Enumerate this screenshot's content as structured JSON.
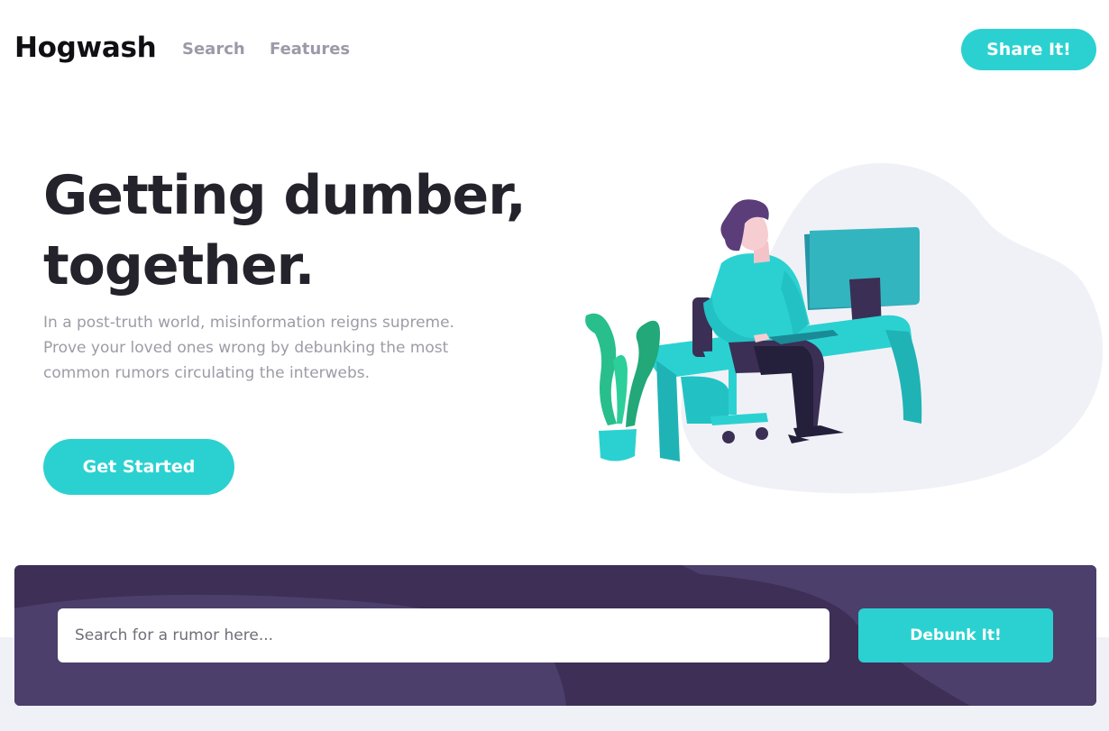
{
  "header": {
    "logo": "Hogwash",
    "nav": [
      {
        "label": "Search"
      },
      {
        "label": "Features"
      }
    ],
    "share_label": "Share It!"
  },
  "hero": {
    "title_line1": "Getting dumber,",
    "title_line2": "together.",
    "description": "In a post-truth world, misinformation reigns supreme. Prove your loved ones wrong by debunking the most common rumors circulating the interwebs.",
    "cta_label": "Get Started",
    "illustration_icon": "person-at-desk-illustration"
  },
  "search": {
    "placeholder": "Search for a rumor here...",
    "value": "",
    "button_label": "Debunk It!"
  },
  "colors": {
    "accent": "#2bd1d1",
    "panel_dark": "#3d2f56",
    "panel_light": "#4c3f6b",
    "heading": "#24232b",
    "muted": "#9d9ba6",
    "blob": "#f0f1f6"
  }
}
